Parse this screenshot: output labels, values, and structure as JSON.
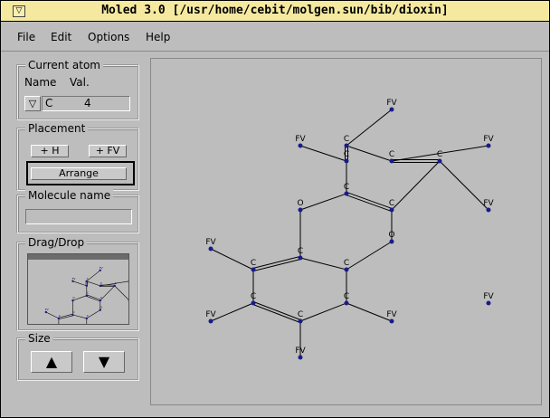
{
  "window": {
    "title": "Moled 3.0 [/usr/home/cebit/molgen.sun/bib/dioxin]",
    "menu_glyph": "▽"
  },
  "menubar": {
    "file": "File",
    "edit": "Edit",
    "options": "Options",
    "help": "Help"
  },
  "current_atom": {
    "legend": "Current atom",
    "name_label": "Name",
    "val_label": "Val.",
    "element": "C",
    "valence": "4",
    "dropdown_glyph": "▽"
  },
  "placement": {
    "legend": "Placement",
    "add_h": "+ H",
    "add_fv": "+ FV",
    "arrange": "Arrange"
  },
  "molecule_name": {
    "legend": "Molecule name",
    "value": ""
  },
  "dragdrop": {
    "legend": "Drag/Drop"
  },
  "size": {
    "legend": "Size",
    "up_glyph": "▲",
    "down_glyph": "▼"
  },
  "colors": {
    "title_bg": "#f5e9a0",
    "panel_bg": "#bdbdbd",
    "atom": "#1a1a8c",
    "bond": "#000000"
  },
  "molecule": {
    "atoms": [
      {
        "label": "FV"
      },
      {
        "label": "FV"
      },
      {
        "label": "C"
      },
      {
        "label": "FV"
      },
      {
        "label": "C"
      },
      {
        "label": "C"
      },
      {
        "label": "C"
      },
      {
        "label": "C"
      },
      {
        "label": "FV"
      },
      {
        "label": "O"
      },
      {
        "label": "C"
      },
      {
        "label": "O"
      },
      {
        "label": "FV"
      },
      {
        "label": "C"
      },
      {
        "label": "C"
      },
      {
        "label": "C"
      },
      {
        "label": "C"
      },
      {
        "label": "FV"
      },
      {
        "label": "C"
      },
      {
        "label": "C"
      },
      {
        "label": "FV"
      },
      {
        "label": "FV"
      },
      {
        "label": "FV"
      }
    ],
    "bonds": [
      [
        0,
        2,
        1
      ],
      [
        1,
        4,
        1
      ],
      [
        3,
        5,
        1
      ],
      [
        2,
        4,
        2
      ],
      [
        2,
        5,
        1
      ],
      [
        5,
        6,
        2
      ],
      [
        4,
        7,
        1
      ],
      [
        6,
        10,
        1
      ],
      [
        6,
        8,
        1
      ],
      [
        7,
        10,
        2
      ],
      [
        7,
        9,
        1
      ],
      [
        9,
        13,
        1
      ],
      [
        10,
        11,
        1
      ],
      [
        11,
        14,
        1
      ],
      [
        13,
        14,
        1
      ],
      [
        13,
        15,
        2
      ],
      [
        14,
        16,
        1
      ],
      [
        15,
        12,
        1
      ],
      [
        15,
        18,
        1
      ],
      [
        18,
        19,
        2
      ],
      [
        19,
        16,
        1
      ],
      [
        16,
        22,
        1
      ],
      [
        18,
        20,
        1
      ],
      [
        19,
        21,
        1
      ]
    ]
  }
}
